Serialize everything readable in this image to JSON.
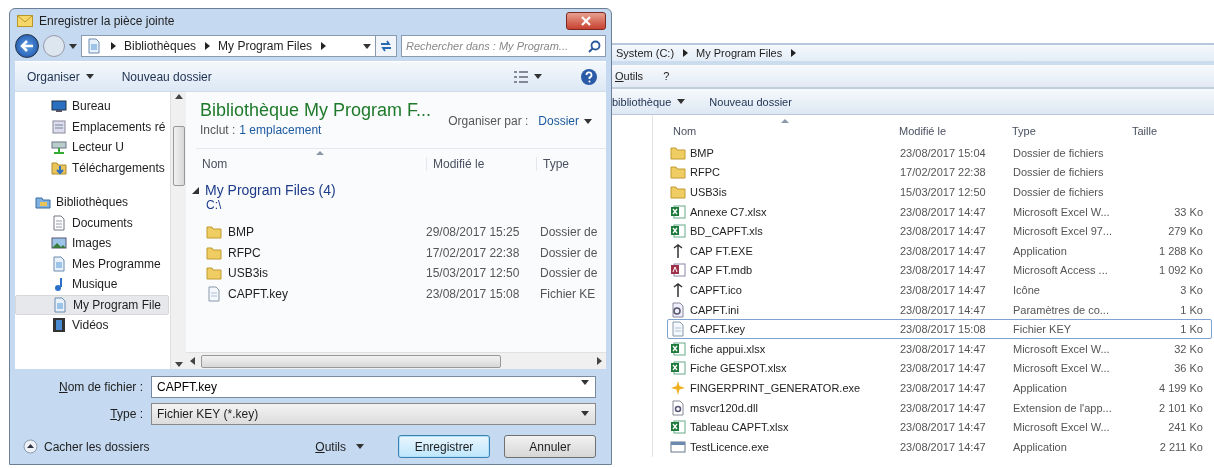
{
  "dialog": {
    "title": "Enregistrer la pièce jointe",
    "address": [
      "Bibliothèques",
      "My Program Files"
    ],
    "search": {
      "placeholder": "Rechercher dans : My Program..."
    },
    "toolbar": [
      {
        "label": "Organiser",
        "kind": "menu"
      },
      {
        "label": "Nouveau dossier",
        "kind": "button"
      }
    ],
    "nav": {
      "favorites": [
        {
          "label": "Bureau",
          "kind": "desktop",
          "selected": false
        },
        {
          "label": "Emplacements ré",
          "kind": "recent",
          "selected": false
        },
        {
          "label": "Lecteur U",
          "kind": "drive",
          "selected": false
        },
        {
          "label": "Téléchargements",
          "kind": "downloads",
          "selected": false
        }
      ],
      "libraries": {
        "label": "Bibliothèques",
        "kind": "library",
        "selected": false,
        "children": [
          {
            "label": "Documents",
            "kind": "documents",
            "selected": false
          },
          {
            "label": "Images",
            "kind": "images",
            "selected": false
          },
          {
            "label": "Mes Programme",
            "kind": "programs",
            "selected": false
          },
          {
            "label": "Musique",
            "kind": "music",
            "selected": false
          },
          {
            "label": "My Program File",
            "kind": "programs",
            "selected": true
          },
          {
            "label": "Vidéos",
            "kind": "videos",
            "selected": false
          }
        ]
      }
    },
    "library_header": {
      "title": "Bibliothèque My Program F...",
      "includes_label": "Inclut :",
      "includes_link": "1 emplacement",
      "arrange_label": "Organiser par :",
      "arrange_value": "Dossier"
    },
    "columns": [
      "Nom",
      "Modifié le",
      "Type"
    ],
    "group": {
      "label": "My Program Files (4)",
      "expanded": true,
      "path": "C:\\"
    },
    "files": [
      {
        "name": "BMP",
        "modified": "29/08/2017 15:25",
        "type": "Dossier de",
        "kind": "folder"
      },
      {
        "name": "RFPC",
        "modified": "17/02/2017 22:38",
        "type": "Dossier de",
        "kind": "folder"
      },
      {
        "name": "USB3is",
        "modified": "15/03/2017 12:50",
        "type": "Dossier de",
        "kind": "folder"
      },
      {
        "name": "CAPFT.key",
        "modified": "23/08/2017 15:08",
        "type": "Fichier KE",
        "kind": "key"
      }
    ],
    "filename": {
      "label": "Nom de fichier :",
      "value": "CAPFT.key"
    },
    "filetype": {
      "label": "Type :",
      "value": "Fichier KEY (*.key)"
    },
    "hide_folders": "Cacher les dossiers",
    "buttons": [
      {
        "label": "Outils",
        "kind": "menu"
      },
      {
        "label": "Enregistrer",
        "kind": "default"
      },
      {
        "label": "Annuler",
        "kind": "normal"
      }
    ]
  },
  "explorer": {
    "address": [
      "System (C:)",
      "My Program Files"
    ],
    "menu": [
      "Outils",
      "?"
    ],
    "toolbar": [
      {
        "label": "bibliothèque",
        "kind": "menu"
      },
      {
        "label": "Nouveau dossier",
        "kind": "button"
      }
    ],
    "columns": [
      "Nom",
      "Modifié le",
      "Type",
      "Taille"
    ],
    "files": [
      {
        "name": "BMP",
        "modified": "23/08/2017 15:04",
        "type": "Dossier de fichiers",
        "kind": "folder",
        "selected": false
      },
      {
        "name": "RFPC",
        "modified": "17/02/2017 22:38",
        "type": "Dossier de fichiers",
        "kind": "folder",
        "selected": false
      },
      {
        "name": "USB3is",
        "modified": "15/03/2017 12:50",
        "type": "Dossier de fichiers",
        "kind": "folder",
        "selected": false
      },
      {
        "name": "Annexe C7.xlsx",
        "modified": "23/08/2017 14:47",
        "type": "Microsoft Excel W...",
        "size": "33 Ko",
        "kind": "excel",
        "selected": false
      },
      {
        "name": "BD_CAPFT.xls",
        "modified": "23/08/2017 14:47",
        "type": "Microsoft Excel 97...",
        "size": "279 Ko",
        "kind": "excel",
        "selected": false
      },
      {
        "name": "CAP FT.EXE",
        "modified": "23/08/2017 14:47",
        "type": "Application",
        "size": "1 288 Ko",
        "kind": "exe",
        "selected": false
      },
      {
        "name": "CAP FT.mdb",
        "modified": "23/08/2017 14:47",
        "type": "Microsoft Access ...",
        "size": "1 092 Ko",
        "kind": "access",
        "selected": false
      },
      {
        "name": "CAPFT.ico",
        "modified": "23/08/2017 14:47",
        "type": "Icône",
        "size": "3 Ko",
        "kind": "exe",
        "selected": false
      },
      {
        "name": "CAPFT.ini",
        "modified": "23/08/2017 14:47",
        "type": "Paramètres de co...",
        "size": "1 Ko",
        "kind": "ini",
        "selected": false
      },
      {
        "name": "CAPFT.key",
        "modified": "23/08/2017 15:08",
        "type": "Fichier KEY",
        "size": "1 Ko",
        "kind": "key",
        "selected": true
      },
      {
        "name": "fiche appui.xlsx",
        "modified": "23/08/2017 14:47",
        "type": "Microsoft Excel W...",
        "size": "32 Ko",
        "kind": "excel",
        "selected": false
      },
      {
        "name": "Fiche GESPOT.xlsx",
        "modified": "23/08/2017 14:47",
        "type": "Microsoft Excel W...",
        "size": "36 Ko",
        "kind": "excel",
        "selected": false
      },
      {
        "name": "FINGERPRINT_GENERATOR.exe",
        "modified": "23/08/2017 14:47",
        "type": "Application",
        "size": "4 199 Ko",
        "kind": "setup",
        "selected": false
      },
      {
        "name": "msvcr120d.dll",
        "modified": "23/08/2017 14:47",
        "type": "Extension de l'app...",
        "size": "2 101 Ko",
        "kind": "dll",
        "selected": false
      },
      {
        "name": "Tableau CAPFT.xlsx",
        "modified": "23/08/2017 14:47",
        "type": "Microsoft Excel W...",
        "size": "241 Ko",
        "kind": "excel",
        "selected": false
      },
      {
        "name": "TestLicence.exe",
        "modified": "23/08/2017 14:47",
        "type": "Application",
        "size": "2 211 Ko",
        "kind": "app",
        "selected": false
      }
    ]
  }
}
